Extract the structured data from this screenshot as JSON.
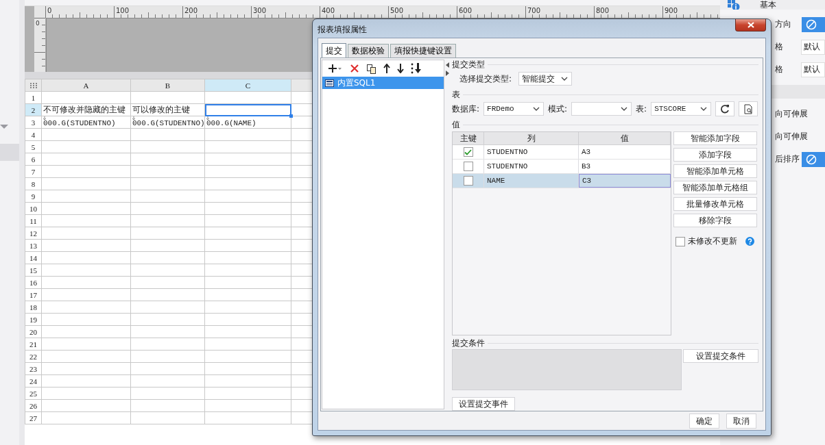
{
  "ruler": {
    "ticks": [
      "0",
      "100",
      "200",
      "300",
      "400",
      "500",
      "600",
      "700",
      "800",
      "900"
    ],
    "vertical_ticks": [
      "0"
    ]
  },
  "sheet": {
    "columns": [
      {
        "label": "A",
        "selected": false
      },
      {
        "label": "B",
        "selected": false
      },
      {
        "label": "C",
        "selected": true
      }
    ],
    "rows": [
      {
        "label": "1",
        "selected": false,
        "cells": []
      },
      {
        "label": "2",
        "selected": true,
        "cells": [
          {
            "text": "不可修改并隐藏的主键",
            "selected": false
          },
          {
            "text": "可以修改的主键",
            "selected": false
          },
          {
            "selected": true
          }
        ]
      },
      {
        "label": "3",
        "selected": false,
        "cells": [
          {
            "text": "000.G(STUDENTNO)",
            "expand": true,
            "selected": false
          },
          {
            "text": "000.G(STUDENTNO)",
            "expand": true,
            "selected": false
          },
          {
            "text": "000.G(NAME)",
            "expand": true,
            "selected": false
          }
        ]
      },
      {
        "label": "4",
        "selected": false,
        "cells": []
      },
      {
        "label": "5",
        "selected": false,
        "cells": []
      },
      {
        "label": "6",
        "selected": false,
        "cells": []
      },
      {
        "label": "7",
        "selected": false,
        "cells": []
      },
      {
        "label": "8",
        "selected": false,
        "cells": []
      },
      {
        "label": "9",
        "selected": false,
        "cells": []
      },
      {
        "label": "10",
        "selected": false,
        "cells": []
      },
      {
        "label": "11",
        "selected": false,
        "cells": []
      },
      {
        "label": "12",
        "selected": false,
        "cells": []
      },
      {
        "label": "13",
        "selected": false,
        "cells": []
      },
      {
        "label": "14",
        "selected": false,
        "cells": []
      },
      {
        "label": "15",
        "selected": false,
        "cells": []
      },
      {
        "label": "16",
        "selected": false,
        "cells": []
      },
      {
        "label": "17",
        "selected": false,
        "cells": []
      },
      {
        "label": "18",
        "selected": false,
        "cells": []
      },
      {
        "label": "19",
        "selected": false,
        "cells": []
      },
      {
        "label": "20",
        "selected": false,
        "cells": []
      },
      {
        "label": "21",
        "selected": false,
        "cells": []
      },
      {
        "label": "22",
        "selected": false,
        "cells": []
      },
      {
        "label": "23",
        "selected": false,
        "cells": []
      },
      {
        "label": "24",
        "selected": false,
        "cells": []
      },
      {
        "label": "25",
        "selected": false,
        "cells": []
      },
      {
        "label": "26",
        "selected": false,
        "cells": []
      },
      {
        "label": "27",
        "selected": false,
        "cells": []
      }
    ]
  },
  "properties": {
    "title": "基本",
    "items": [
      {
        "label": "方向",
        "kind": "button"
      },
      {
        "label": "格",
        "kind": "select",
        "value": "默认"
      },
      {
        "label": "格",
        "kind": "select",
        "value": "默认"
      },
      {
        "kind": "separator"
      },
      {
        "label": "向可伸展",
        "kind": "label"
      },
      {
        "label": "向可伸展",
        "kind": "label"
      },
      {
        "label": "后排序",
        "kind": "button"
      }
    ]
  },
  "dialog": {
    "title": "报表填报属性",
    "tabs": [
      {
        "label": "提交",
        "selected": true
      },
      {
        "label": "数据校验",
        "selected": false
      },
      {
        "label": "填报快捷键设置",
        "selected": false
      }
    ],
    "list": [
      {
        "label": "内置SQL1",
        "selected": true
      }
    ],
    "submit_type": {
      "heading": "提交类型",
      "label": "选择提交类型:",
      "value": "智能提交"
    },
    "table_section": {
      "heading": "表",
      "database_label": "数据库:",
      "database": "FRDemo",
      "schema_label": "模式:",
      "table_label": "表:",
      "table": "STSCORE"
    },
    "values": {
      "heading": "值",
      "columns": [
        "主键",
        "列",
        "值"
      ],
      "rows": [
        {
          "key": true,
          "column": "STUDENTNO",
          "value": "A3",
          "selected": false
        },
        {
          "key": false,
          "column": "STUDENTNO",
          "value": "B3",
          "selected": false
        },
        {
          "key": false,
          "column": "NAME",
          "value": "C3",
          "selected": true
        }
      ]
    },
    "actions": [
      "智能添加字段",
      "添加字段",
      "智能添加单元格",
      "智能添加单元格组",
      "批量修改单元格",
      "移除字段"
    ],
    "no_update": {
      "label": "未修改不更新",
      "checked": false
    },
    "condition": {
      "heading": "提交条件",
      "button": "设置提交条件"
    },
    "event_button": "设置提交事件",
    "buttons": [
      "确定",
      "取消"
    ]
  }
}
